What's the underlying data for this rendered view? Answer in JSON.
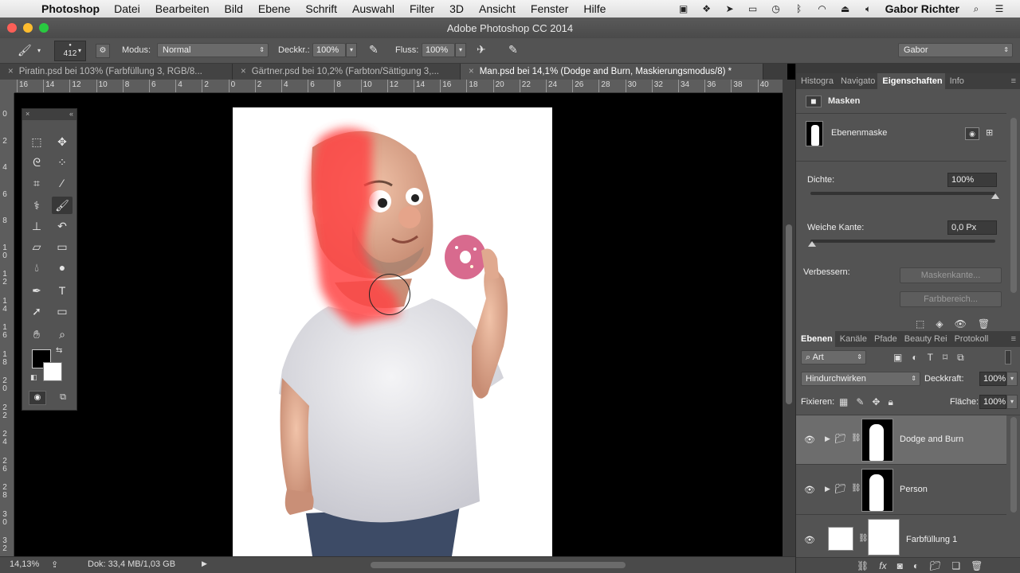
{
  "menubar": {
    "app": "Photoshop",
    "items": [
      "Datei",
      "Bearbeiten",
      "Bild",
      "Ebene",
      "Schrift",
      "Auswahl",
      "Filter",
      "3D",
      "Ansicht",
      "Fenster",
      "Hilfe"
    ],
    "user": "Gabor Richter"
  },
  "window": {
    "title": "Adobe Photoshop CC 2014"
  },
  "options": {
    "brush_size": "412",
    "modus_label": "Modus:",
    "modus_value": "Normal",
    "opacity_label": "Deckkr.:",
    "opacity_value": "100%",
    "flow_label": "Fluss:",
    "flow_value": "100%",
    "workspace": "Gabor"
  },
  "tabs": [
    "Piratin.psd bei 103% (Farbfüllung 3, RGB/8...",
    "Gärtner.psd bei 10,2% (Farbton/Sättigung 3,...",
    "Man.psd bei 14,1% (Dodge and Burn, Maskierungsmodus/8) *"
  ],
  "ruler": {
    "h": [
      "16",
      "14",
      "12",
      "10",
      "8",
      "6",
      "4",
      "2",
      "0",
      "2",
      "4",
      "6",
      "8",
      "10",
      "12",
      "14",
      "16",
      "18",
      "20",
      "22",
      "24",
      "26",
      "28",
      "30",
      "32",
      "34",
      "36",
      "38",
      "40"
    ],
    "v": [
      "0",
      "2",
      "4",
      "6",
      "8",
      "10",
      "12",
      "14",
      "16",
      "18",
      "20",
      "22",
      "24",
      "26",
      "28",
      "30",
      "32"
    ]
  },
  "status": {
    "zoom": "14,13%",
    "doc": "Dok: 33,4 MB/1,03 GB"
  },
  "properties": {
    "tabs": [
      "Histogra",
      "Navigato",
      "Eigenschaften",
      "Info"
    ],
    "heading": "Masken",
    "mask_label": "Ebenenmaske",
    "density_label": "Dichte:",
    "density_value": "100%",
    "density": 1.0,
    "feather_label": "Weiche Kante:",
    "feather_value": "0,0 Px",
    "feather": 0.0,
    "refine_label": "Verbessern:",
    "btn_edge": "Maskenkante...",
    "btn_color": "Farbbereich..."
  },
  "layers": {
    "tabs": [
      "Ebenen",
      "Kanäle",
      "Pfade",
      "Beauty Rei",
      "Protokoll"
    ],
    "filter": "Art",
    "blend": "Hindurchwirken",
    "opacity_label": "Deckkraft:",
    "opacity_value": "100%",
    "lock_label": "Fixieren:",
    "fill_label": "Fläche:",
    "fill_value": "100%",
    "items": [
      {
        "name": "Dodge and Burn",
        "selected": true
      },
      {
        "name": "Person",
        "selected": false
      },
      {
        "name": "Farbfüllung 1",
        "selected": false
      }
    ]
  },
  "colors": {
    "quickmask": "#ff5050",
    "panel": "#535353"
  }
}
